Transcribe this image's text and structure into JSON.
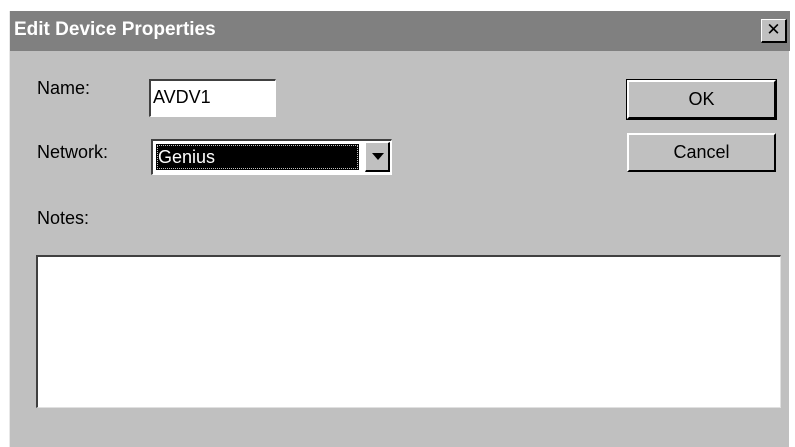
{
  "window": {
    "title": "Edit Device Properties",
    "close_glyph": "✕",
    "close_icon": "close-icon"
  },
  "form": {
    "name_label": "Name:",
    "name_value": "AVDV1",
    "network_label": "Network:",
    "network_value": "Genius",
    "network_dropdown_icon": "chevron-down-icon",
    "notes_label": "Notes:",
    "notes_value": ""
  },
  "buttons": {
    "ok_label": "OK",
    "cancel_label": "Cancel"
  },
  "colors": {
    "titlebar": "#808080",
    "dialog_face": "#c0c0c0",
    "selection_bg": "#000000"
  }
}
